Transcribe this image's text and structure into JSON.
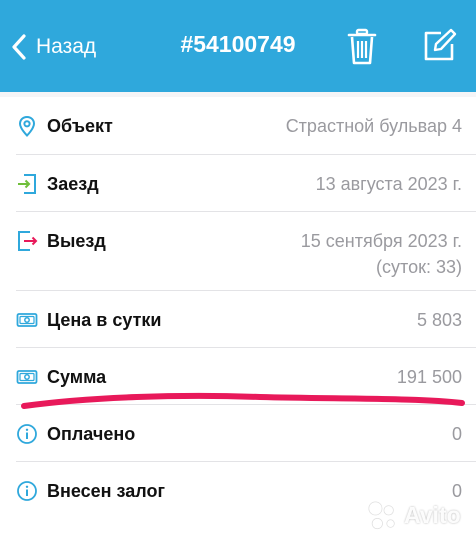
{
  "header": {
    "back_label": "Назад",
    "order_id": "#54100749",
    "background_color": "#2fa8dc"
  },
  "rows": [
    {
      "icon": "location-pin-icon",
      "label": "Объект",
      "value": "Страстной бульвар 4"
    },
    {
      "icon": "check-in-icon",
      "label": "Заезд",
      "value": "13 августа 2023 г."
    },
    {
      "icon": "check-out-icon",
      "label": "Выезд",
      "value": "15 сентября 2023 г.",
      "sub": "(суток: 33)"
    },
    {
      "icon": "banknote-icon",
      "label": "Цена в сутки",
      "value": "5 803"
    },
    {
      "icon": "banknote-icon",
      "label": "Сумма",
      "value": "191 500"
    },
    {
      "icon": "info-icon",
      "label": "Оплачено",
      "value": "0"
    },
    {
      "icon": "info-icon",
      "label": "Внесен залог",
      "value": "0"
    }
  ],
  "watermark": {
    "text": "Avito"
  },
  "colors": {
    "accent": "#2fa8dc",
    "highlight_stroke": "#e8195a"
  }
}
